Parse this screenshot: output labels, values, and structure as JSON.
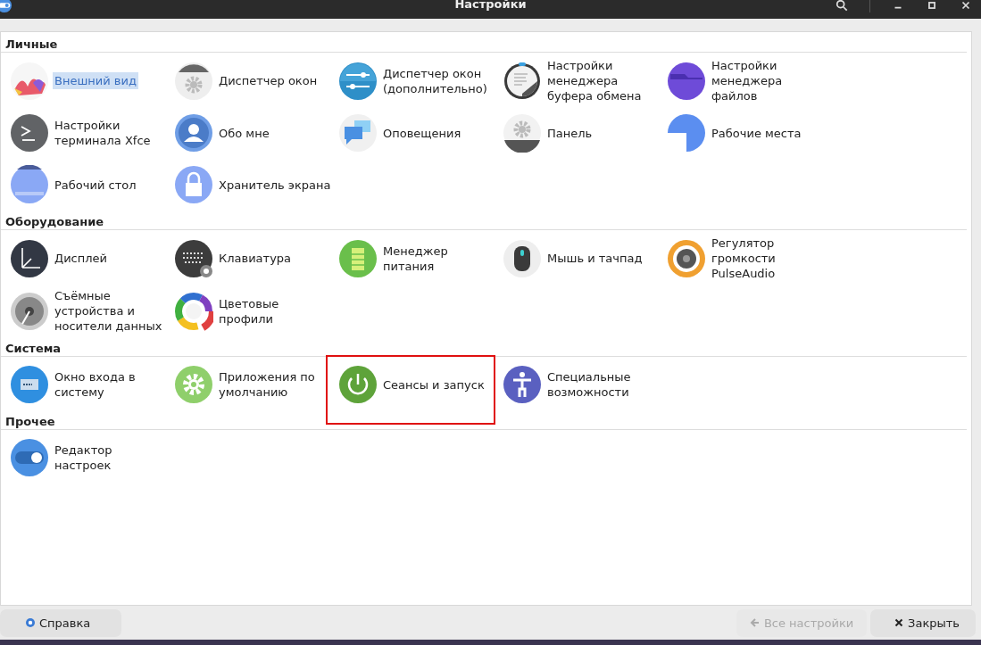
{
  "window": {
    "title": "Настройки"
  },
  "sections": [
    {
      "title": "Личные",
      "items": [
        {
          "label": "Внешний вид",
          "kind": "appearance",
          "selected": true,
          "outlined": false
        },
        {
          "label": "Диспетчер окон",
          "kind": "window-gear",
          "selected": false,
          "outlined": false
        },
        {
          "label": "Диспетчер окон (дополнительно)",
          "kind": "sliders",
          "selected": false,
          "outlined": false
        },
        {
          "label": "Настройки менеджера буфера обмена",
          "kind": "clipboard",
          "selected": false,
          "outlined": false
        },
        {
          "label": "Настройки менеджера файлов",
          "kind": "folder",
          "selected": false,
          "outlined": false
        },
        {
          "label": "Настройки терминала Xfce",
          "kind": "terminal",
          "selected": false,
          "outlined": false
        },
        {
          "label": "Обо мне",
          "kind": "person",
          "selected": false,
          "outlined": false
        },
        {
          "label": "Оповещения",
          "kind": "chat",
          "selected": false,
          "outlined": false
        },
        {
          "label": "Панель",
          "kind": "panel",
          "selected": false,
          "outlined": false
        },
        {
          "label": "Рабочие места",
          "kind": "workspaces",
          "selected": false,
          "outlined": false
        },
        {
          "label": "Рабочий стол",
          "kind": "desktop",
          "selected": false,
          "outlined": false
        },
        {
          "label": "Хранитель экрана",
          "kind": "lock",
          "selected": false,
          "outlined": false
        }
      ]
    },
    {
      "title": "Оборудование",
      "items": [
        {
          "label": "Дисплей",
          "kind": "display",
          "selected": false,
          "outlined": false
        },
        {
          "label": "Клавиатура",
          "kind": "keyboard",
          "selected": false,
          "outlined": false
        },
        {
          "label": "Менеджер питания",
          "kind": "battery",
          "selected": false,
          "outlined": false
        },
        {
          "label": "Мышь и тачпад",
          "kind": "mouse",
          "selected": false,
          "outlined": false
        },
        {
          "label": "Регулятор громкости PulseAudio",
          "kind": "speaker",
          "selected": false,
          "outlined": false
        },
        {
          "label": "Съёмные устройства и носители данных",
          "kind": "disk",
          "selected": false,
          "outlined": false
        },
        {
          "label": "Цветовые профили",
          "kind": "colorwheel",
          "selected": false,
          "outlined": false
        }
      ]
    },
    {
      "title": "Система",
      "items": [
        {
          "label": "Окно входа в систему",
          "kind": "login",
          "selected": false,
          "outlined": false
        },
        {
          "label": "Приложения по умолчанию",
          "kind": "gear",
          "selected": false,
          "outlined": false
        },
        {
          "label": "Сеансы и запуск",
          "kind": "power",
          "selected": false,
          "outlined": true
        },
        {
          "label": "Специальные возможности",
          "kind": "accessibility",
          "selected": false,
          "outlined": false
        }
      ]
    },
    {
      "title": "Прочее",
      "items": [
        {
          "label": "Редактор настроек",
          "kind": "toggle",
          "selected": false,
          "outlined": false
        }
      ]
    }
  ],
  "buttons": [
    {
      "label": "Справка",
      "kind": "help",
      "disabled": false
    },
    {
      "label": "Все настройки",
      "kind": "back",
      "disabled": true
    },
    {
      "label": "Закрыть",
      "kind": "close",
      "disabled": false
    }
  ]
}
